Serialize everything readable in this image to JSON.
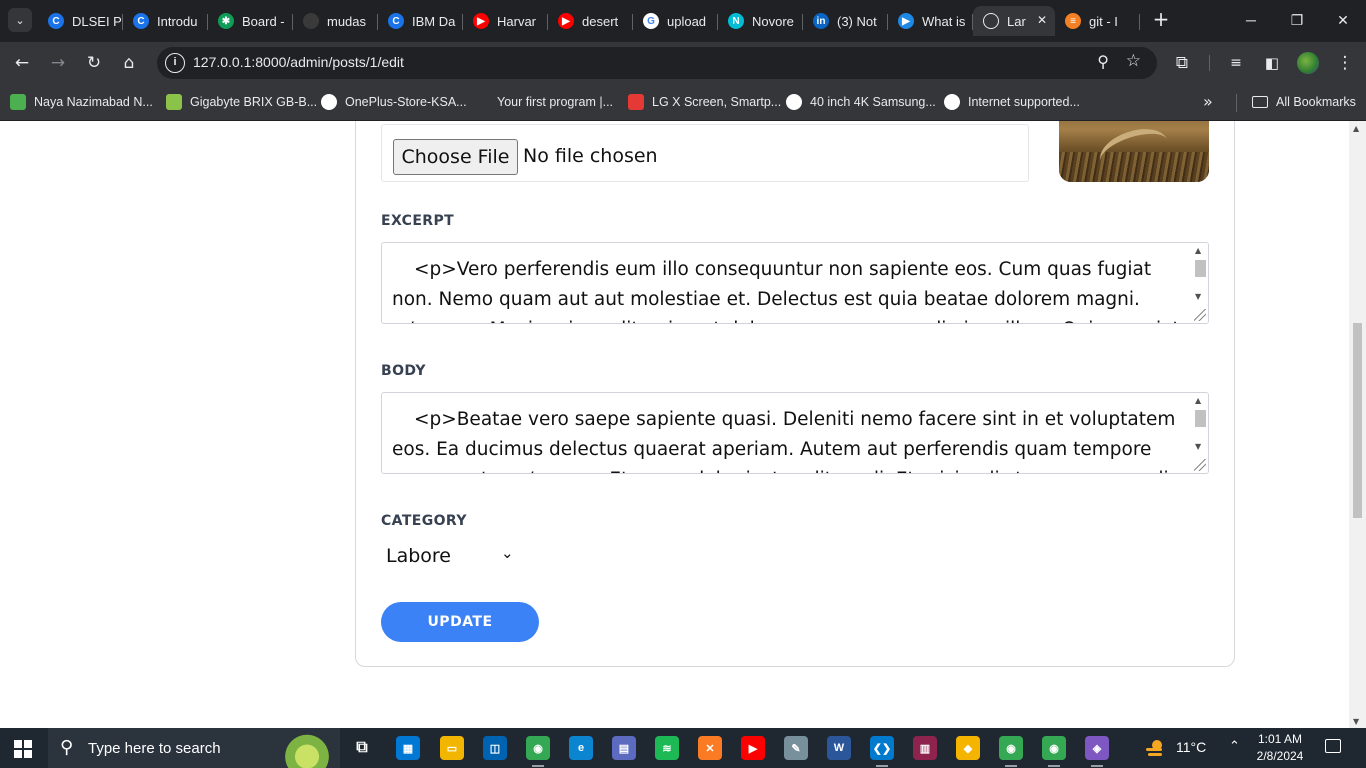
{
  "browser": {
    "tabs": [
      {
        "label": "DLSEI P",
        "icon_name": "chrome-icon-blue",
        "color": "#1a73e8",
        "glyph": "C"
      },
      {
        "label": "Introdu",
        "icon_name": "chrome-icon-blue",
        "color": "#1a73e8",
        "glyph": "C"
      },
      {
        "label": "Board -",
        "icon_name": "star-icon",
        "color": "#0f9d58",
        "glyph": "✱"
      },
      {
        "label": "mudas",
        "icon_name": "github-icon",
        "color": "#3a3a3a",
        "glyph": ""
      },
      {
        "label": "IBM Da",
        "icon_name": "chrome-icon-blue",
        "color": "#1a73e8",
        "glyph": "C"
      },
      {
        "label": "Harvar",
        "icon_name": "youtube-icon",
        "color": "#ff0000",
        "glyph": "▶"
      },
      {
        "label": "desert",
        "icon_name": "youtube-icon",
        "color": "#ff0000",
        "glyph": "▶"
      },
      {
        "label": "upload",
        "icon_name": "google-icon",
        "color": "#ffffff",
        "glyph": "G"
      },
      {
        "label": "Novore",
        "icon_name": "n-icon",
        "color": "#00bcd4",
        "glyph": "N"
      },
      {
        "label": "(3) Not",
        "icon_name": "linkedin-icon",
        "color": "#0a66c2",
        "glyph": "in"
      },
      {
        "label": "What is",
        "icon_name": "video-icon",
        "color": "#1e88e5",
        "glyph": "▶"
      }
    ],
    "active_tab": {
      "label": "Lar",
      "icon_name": "globe-icon",
      "close": "✕"
    },
    "tab_after": {
      "label": "git - I",
      "icon_name": "stackoverflow-icon",
      "color": "#f48024",
      "glyph": "≡"
    },
    "new_tab": "+",
    "window": {
      "minimize": "─",
      "maximize": "❐",
      "close": "✕"
    },
    "url": "127.0.0.1:8000/admin/posts/1/edit",
    "bookmarks": [
      {
        "label": "Naya Nazimabad N...",
        "icon_name": "house-icon",
        "color": "#4caf50"
      },
      {
        "label": "Gigabyte BRIX GB-B...",
        "icon_name": "home-icon",
        "color": "#8bc34a"
      },
      {
        "label": "OnePlus-Store-KSA...",
        "icon_name": "amazon-icon",
        "color": "#ffffff"
      },
      {
        "label": "Your first program |...",
        "icon_name": "blank-icon",
        "color": "#35363a"
      },
      {
        "label": "LG X Screen, Smartp...",
        "icon_name": "red-circle-icon",
        "color": "#e53935"
      },
      {
        "label": "40 inch 4K Samsung...",
        "icon_name": "olx-icon",
        "color": "#ffffff"
      },
      {
        "label": "Internet supported...",
        "icon_name": "olx-icon",
        "color": "#ffffff"
      }
    ],
    "all_bookmarks": "All Bookmarks"
  },
  "page": {
    "file": {
      "button": "Choose File",
      "status": "No file chosen"
    },
    "excerpt": {
      "label": "EXCERPT",
      "value": "<p>Vero perferendis eum illo consequuntur non sapiente eos. Cum quas fugiat non. Nemo quam aut aut molestiae et. Delectus est quia beatae dolorem magni.</p> <p>Maxime impedit quia aut dolorem accusamus odio iure illum. Quia eveniet mollitia ut.</p>"
    },
    "body": {
      "label": "BODY",
      "value": "<p>Beatae vero saepe sapiente quasi. Deleniti nemo facere sint in et voluptatem eos. Ea ducimus delectus quaerat aperiam. Autem aut perferendis quam tempore consequatur.</p> <p>Et nemo dolor iusto odit modi. Et reiciendis tempora quo odio.</p>"
    },
    "category": {
      "label": "CATEGORY",
      "selected": "Labore"
    },
    "update_button": "UPDATE",
    "accent_color": "#3b82f6"
  },
  "taskbar": {
    "search_placeholder": "Type here to search",
    "apps": [
      {
        "name": "task-view-icon",
        "color": "#1f2731",
        "glyph": "⧉"
      },
      {
        "name": "store-icon",
        "color": "#0078d4",
        "glyph": "▦"
      },
      {
        "name": "file-explorer-icon",
        "color": "#f2b600",
        "glyph": "▭"
      },
      {
        "name": "app-icon",
        "color": "#0063b1",
        "glyph": "◫"
      },
      {
        "name": "chrome-icon",
        "color": "#34a853",
        "glyph": "◉"
      },
      {
        "name": "edge-icon",
        "color": "#0c85d0",
        "glyph": "e"
      },
      {
        "name": "network-icon",
        "color": "#5c6bc0",
        "glyph": "▤"
      },
      {
        "name": "spotify-icon",
        "color": "#1db954",
        "glyph": "≋"
      },
      {
        "name": "xampp-icon",
        "color": "#fb7a24",
        "glyph": "✕"
      },
      {
        "name": "youtube-icon",
        "color": "#ff0000",
        "glyph": "▶"
      },
      {
        "name": "notepad-icon",
        "color": "#78909c",
        "glyph": "✎"
      },
      {
        "name": "word-icon",
        "color": "#2b579a",
        "glyph": "W"
      },
      {
        "name": "vscode-icon",
        "color": "#007acc",
        "glyph": "❮❯"
      },
      {
        "name": "winrar-icon",
        "color": "#8e244d",
        "glyph": "▥"
      },
      {
        "name": "duck-icon",
        "color": "#f5b400",
        "glyph": "◆"
      },
      {
        "name": "chrome-profile-icon",
        "color": "#34a853",
        "glyph": "◉"
      },
      {
        "name": "chrome-icon-2",
        "color": "#34a853",
        "glyph": "◉"
      },
      {
        "name": "git-icon",
        "color": "#7e57c2",
        "glyph": "◈"
      }
    ],
    "temperature": "11°C",
    "time": "1:01 AM",
    "date": "2/8/2024"
  }
}
